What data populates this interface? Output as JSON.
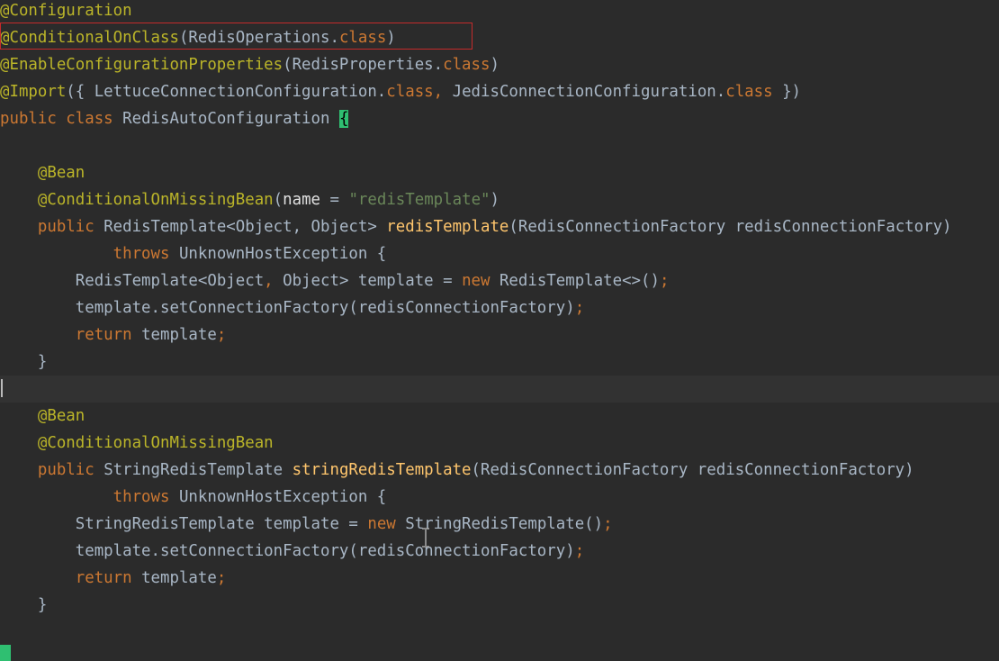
{
  "editor": {
    "colors": {
      "background": "#2b2b2b",
      "current_line": "#323232",
      "annotation": "#bbb529",
      "keyword": "#cc7832",
      "string": "#6a8759",
      "method": "#ffc66d",
      "text": "#a9b7c6",
      "highlight_box": "#c42a2a",
      "brace_match": "#2fbf71"
    },
    "lines": [
      {
        "tokens": [
          {
            "t": "@Configuration",
            "c": "ann"
          }
        ]
      },
      {
        "tokens": [
          {
            "t": "@ConditionalOnClass",
            "c": "ann"
          },
          {
            "t": "(RedisOperations.",
            "c": "txt"
          },
          {
            "t": "class",
            "c": "kw"
          },
          {
            "t": ")",
            "c": "txt"
          }
        ]
      },
      {
        "tokens": [
          {
            "t": "@EnableConfigurationProperties",
            "c": "ann"
          },
          {
            "t": "(RedisProperties.",
            "c": "txt"
          },
          {
            "t": "class",
            "c": "kw"
          },
          {
            "t": ")",
            "c": "txt"
          }
        ]
      },
      {
        "tokens": [
          {
            "t": "@Import",
            "c": "ann"
          },
          {
            "t": "({ LettuceConnectionConfiguration.",
            "c": "txt"
          },
          {
            "t": "class",
            "c": "kw"
          },
          {
            "t": ", ",
            "c": "kw"
          },
          {
            "t": "JedisConnectionConfiguration.",
            "c": "txt"
          },
          {
            "t": "class",
            "c": "kw"
          },
          {
            "t": " })",
            "c": "txt"
          }
        ]
      },
      {
        "tokens": [
          {
            "t": "public class ",
            "c": "kw"
          },
          {
            "t": "RedisAutoConfiguration ",
            "c": "txt"
          },
          {
            "t": "{",
            "c": "brace"
          }
        ]
      },
      {
        "tokens": []
      },
      {
        "tokens": [
          {
            "t": "    ",
            "c": "txt"
          },
          {
            "t": "@Bean",
            "c": "ann"
          }
        ]
      },
      {
        "tokens": [
          {
            "t": "    ",
            "c": "txt"
          },
          {
            "t": "@ConditionalOnMissingBean",
            "c": "ann"
          },
          {
            "t": "(",
            "c": "txt"
          },
          {
            "t": "name",
            "c": "param"
          },
          {
            "t": " = ",
            "c": "txt"
          },
          {
            "t": "\"redisTemplate\"",
            "c": "str"
          },
          {
            "t": ")",
            "c": "txt"
          }
        ]
      },
      {
        "tokens": [
          {
            "t": "    ",
            "c": "txt"
          },
          {
            "t": "public ",
            "c": "kw"
          },
          {
            "t": "RedisTemplate<Object, Object> ",
            "c": "txt"
          },
          {
            "t": "redisTemplate",
            "c": "fn"
          },
          {
            "t": "(RedisConnectionFactory redisConnectionFactory)",
            "c": "txt"
          }
        ]
      },
      {
        "tokens": [
          {
            "t": "            ",
            "c": "txt"
          },
          {
            "t": "throws ",
            "c": "kw"
          },
          {
            "t": "UnknownHostException {",
            "c": "txt"
          }
        ]
      },
      {
        "tokens": [
          {
            "t": "        ",
            "c": "txt"
          },
          {
            "t": "RedisTemplate<Object",
            "c": "txt"
          },
          {
            "t": ", ",
            "c": "kw"
          },
          {
            "t": "Object> template = ",
            "c": "txt"
          },
          {
            "t": "new ",
            "c": "kw"
          },
          {
            "t": "RedisTemplate<>()",
            "c": "txt"
          },
          {
            "t": ";",
            "c": "kw"
          }
        ]
      },
      {
        "tokens": [
          {
            "t": "        ",
            "c": "txt"
          },
          {
            "t": "template.setConnectionFactory(redisConnectionFactory)",
            "c": "txt"
          },
          {
            "t": ";",
            "c": "kw"
          }
        ]
      },
      {
        "tokens": [
          {
            "t": "        ",
            "c": "txt"
          },
          {
            "t": "return ",
            "c": "kw"
          },
          {
            "t": "template",
            "c": "txt"
          },
          {
            "t": ";",
            "c": "kw"
          }
        ]
      },
      {
        "tokens": [
          {
            "t": "    }",
            "c": "txt"
          }
        ]
      },
      {
        "tokens": [],
        "current": true
      },
      {
        "tokens": [
          {
            "t": "    ",
            "c": "txt"
          },
          {
            "t": "@Bean",
            "c": "ann"
          }
        ]
      },
      {
        "tokens": [
          {
            "t": "    ",
            "c": "txt"
          },
          {
            "t": "@ConditionalOnMissingBean",
            "c": "ann"
          }
        ]
      },
      {
        "tokens": [
          {
            "t": "    ",
            "c": "txt"
          },
          {
            "t": "public ",
            "c": "kw"
          },
          {
            "t": "StringRedisTemplate ",
            "c": "txt"
          },
          {
            "t": "stringRedisTemplate",
            "c": "fn"
          },
          {
            "t": "(RedisConnectionFactory redisConnectionFactory)",
            "c": "txt"
          }
        ]
      },
      {
        "tokens": [
          {
            "t": "            ",
            "c": "txt"
          },
          {
            "t": "throws ",
            "c": "kw"
          },
          {
            "t": "UnknownHostException {",
            "c": "txt"
          }
        ]
      },
      {
        "tokens": [
          {
            "t": "        ",
            "c": "txt"
          },
          {
            "t": "StringRedisTemplate template = ",
            "c": "txt"
          },
          {
            "t": "new ",
            "c": "kw"
          },
          {
            "t": "StringRedisTemplate()",
            "c": "txt"
          },
          {
            "t": ";",
            "c": "kw"
          }
        ]
      },
      {
        "tokens": [
          {
            "t": "        ",
            "c": "txt"
          },
          {
            "t": "template.setConnectionFactory(redisConnectionFactory)",
            "c": "txt"
          },
          {
            "t": ";",
            "c": "kw"
          }
        ]
      },
      {
        "tokens": [
          {
            "t": "        ",
            "c": "txt"
          },
          {
            "t": "return ",
            "c": "kw"
          },
          {
            "t": "template",
            "c": "txt"
          },
          {
            "t": ";",
            "c": "kw"
          }
        ]
      },
      {
        "tokens": [
          {
            "t": "    }",
            "c": "txt"
          }
        ]
      }
    ]
  }
}
